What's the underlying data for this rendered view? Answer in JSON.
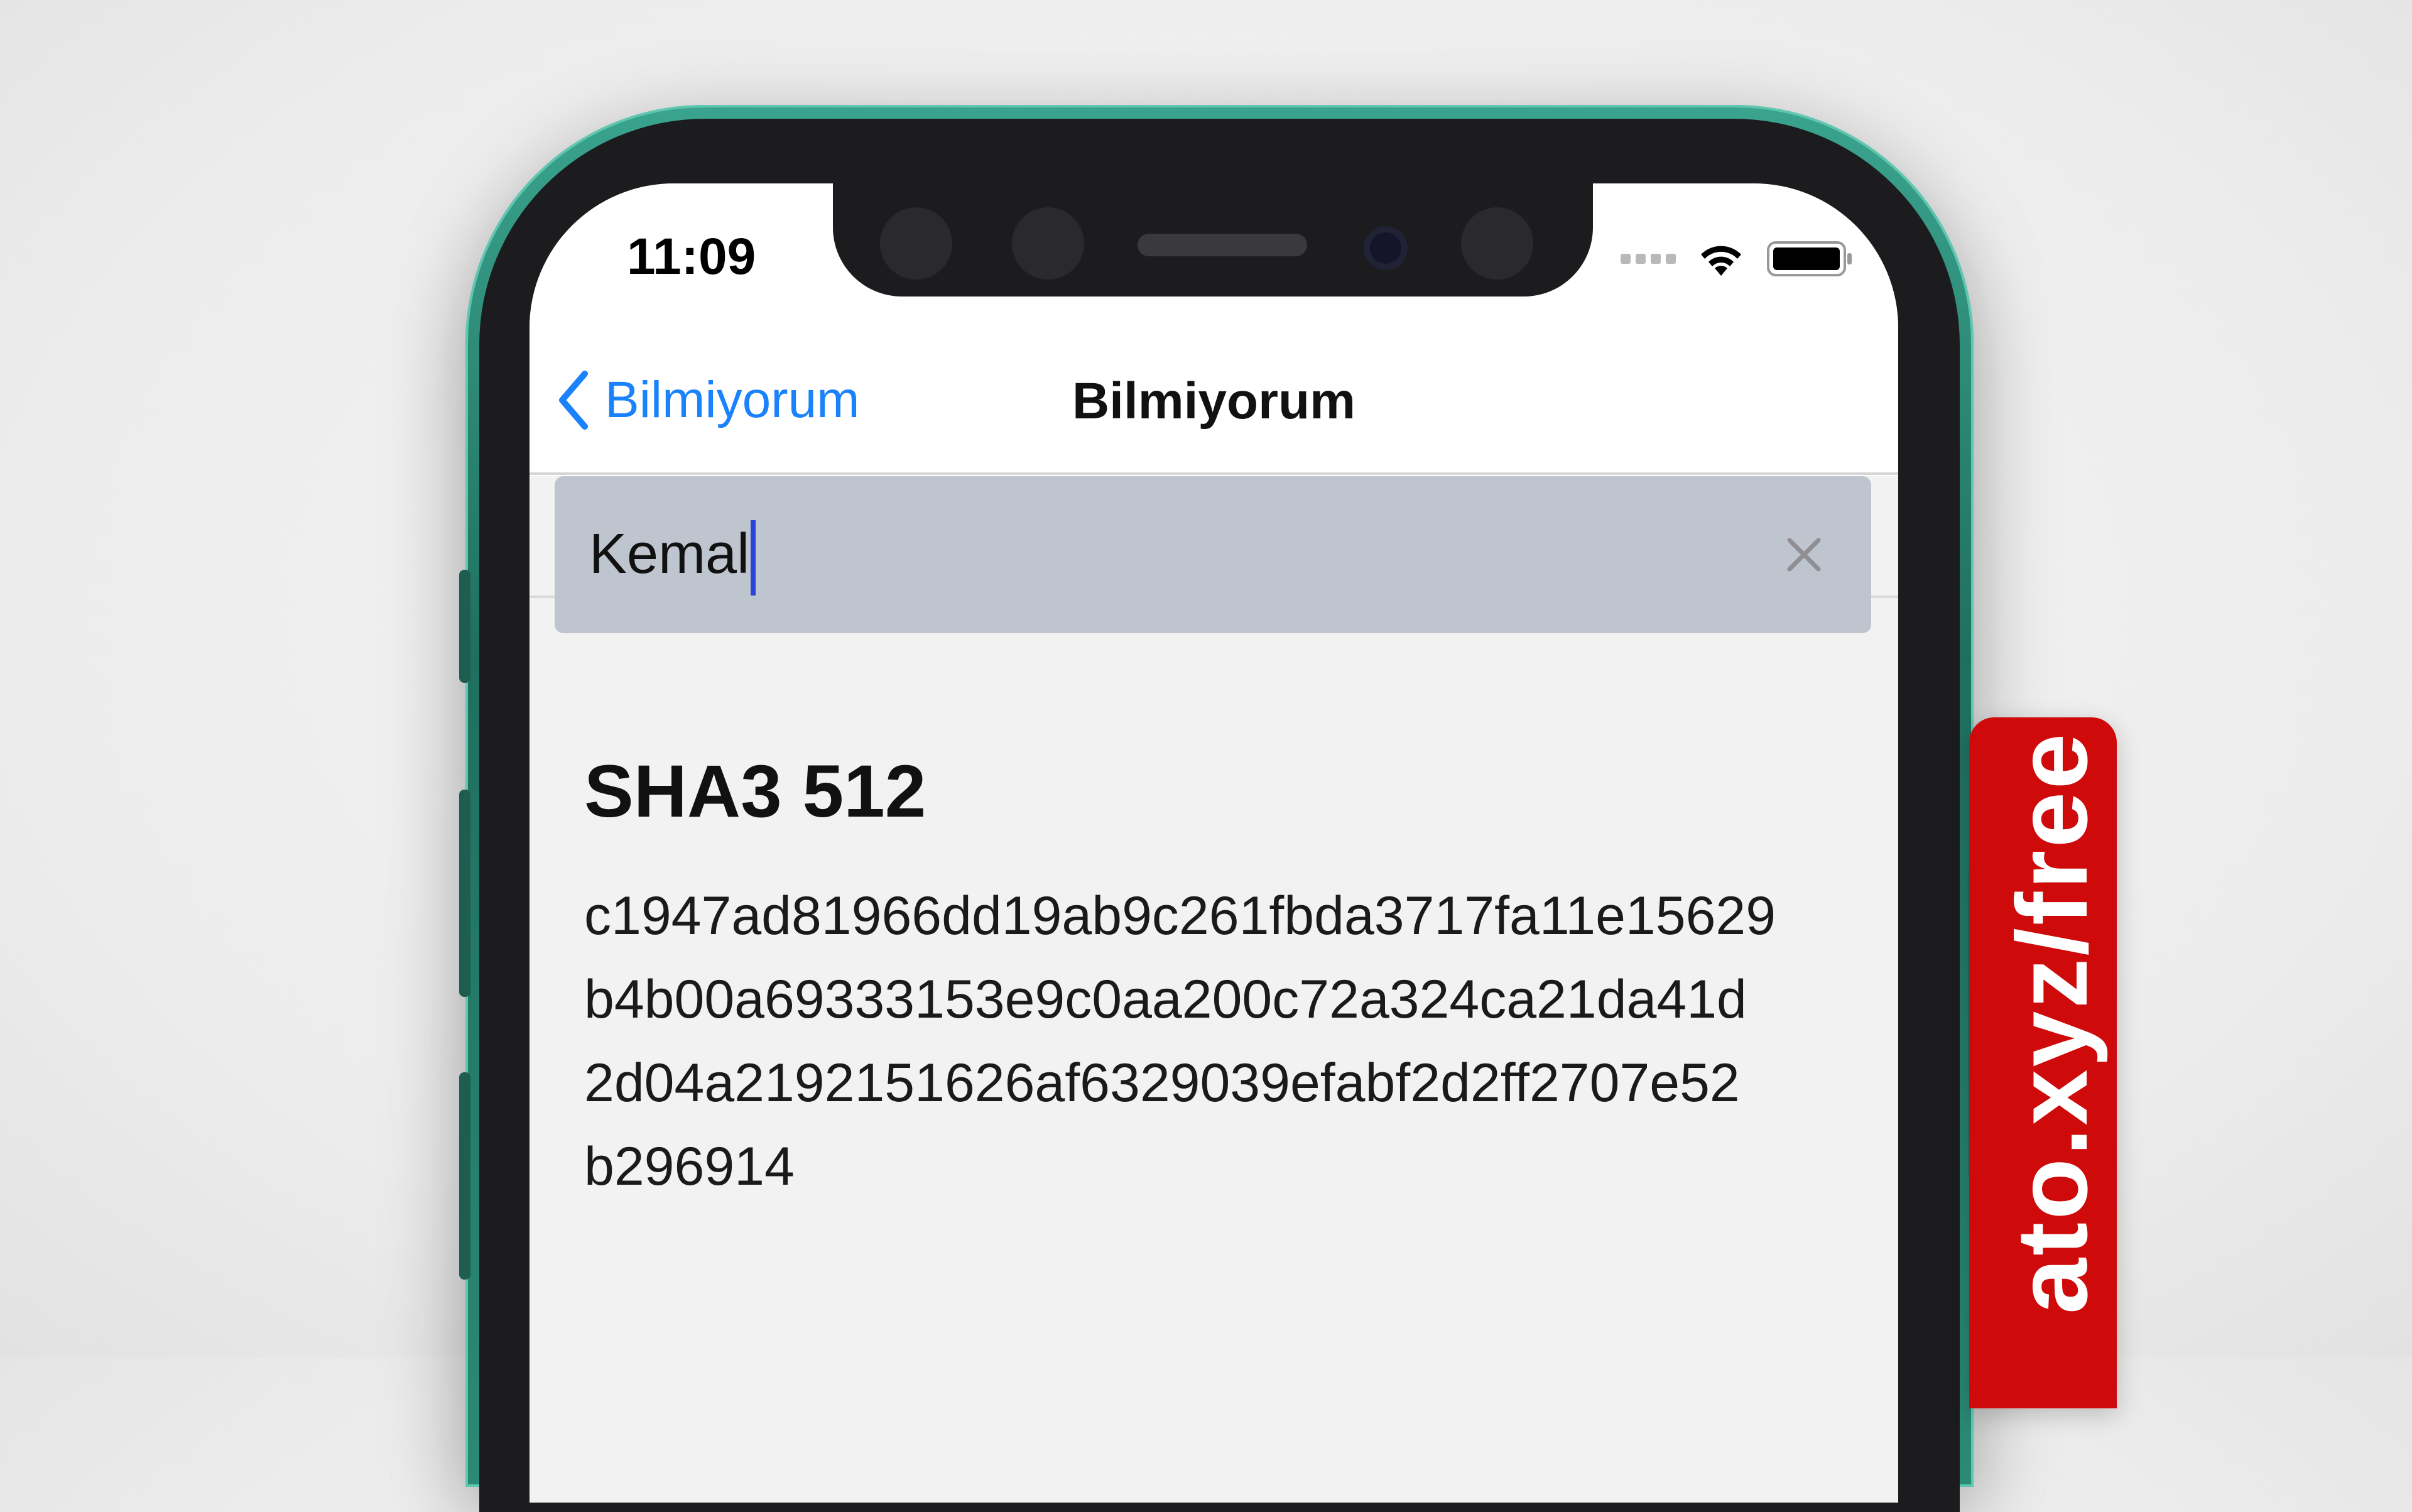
{
  "status_bar": {
    "time": "11:09"
  },
  "nav": {
    "back_label": "Bilmiyorum",
    "title": "Bilmiyorum"
  },
  "search": {
    "value": "Kemal"
  },
  "result": {
    "title": "SHA3 512",
    "hash_lines": [
      "c1947ad81966dd19ab9c261fbda3717fa11e15629",
      "b4b00a69333153e9c0aa200c72a324ca21da41d",
      "2d04a2192151626af6329039efabf2d2ff2707e52",
      "b296914"
    ]
  },
  "ribbon": {
    "text": "ato.xyz/free"
  },
  "colors": {
    "accent": "#1a82fb",
    "ribbon": "#cf0a0a",
    "phone_frame": "#2a8a76"
  }
}
